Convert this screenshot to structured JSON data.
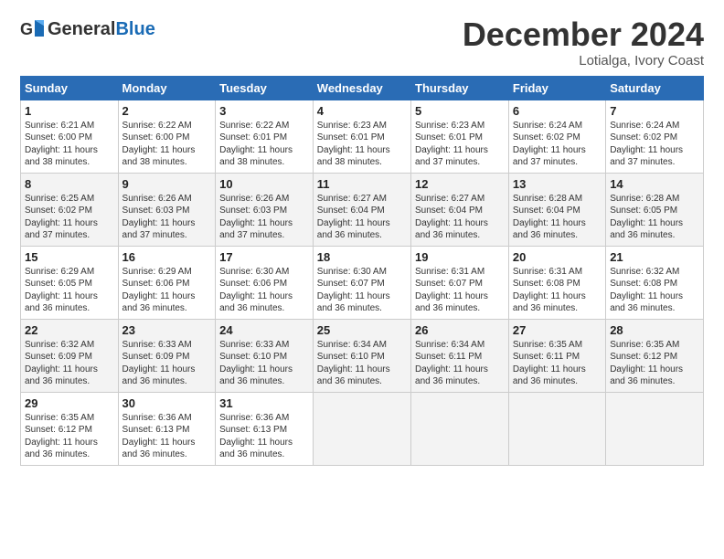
{
  "logo": {
    "general": "General",
    "blue": "Blue"
  },
  "title": "December 2024",
  "location": "Lotialga, Ivory Coast",
  "days_of_week": [
    "Sunday",
    "Monday",
    "Tuesday",
    "Wednesday",
    "Thursday",
    "Friday",
    "Saturday"
  ],
  "weeks": [
    [
      {
        "day": "1",
        "info": "Sunrise: 6:21 AM\nSunset: 6:00 PM\nDaylight: 11 hours\nand 38 minutes."
      },
      {
        "day": "2",
        "info": "Sunrise: 6:22 AM\nSunset: 6:00 PM\nDaylight: 11 hours\nand 38 minutes."
      },
      {
        "day": "3",
        "info": "Sunrise: 6:22 AM\nSunset: 6:01 PM\nDaylight: 11 hours\nand 38 minutes."
      },
      {
        "day": "4",
        "info": "Sunrise: 6:23 AM\nSunset: 6:01 PM\nDaylight: 11 hours\nand 38 minutes."
      },
      {
        "day": "5",
        "info": "Sunrise: 6:23 AM\nSunset: 6:01 PM\nDaylight: 11 hours\nand 37 minutes."
      },
      {
        "day": "6",
        "info": "Sunrise: 6:24 AM\nSunset: 6:02 PM\nDaylight: 11 hours\nand 37 minutes."
      },
      {
        "day": "7",
        "info": "Sunrise: 6:24 AM\nSunset: 6:02 PM\nDaylight: 11 hours\nand 37 minutes."
      }
    ],
    [
      {
        "day": "8",
        "info": "Sunrise: 6:25 AM\nSunset: 6:02 PM\nDaylight: 11 hours\nand 37 minutes."
      },
      {
        "day": "9",
        "info": "Sunrise: 6:26 AM\nSunset: 6:03 PM\nDaylight: 11 hours\nand 37 minutes."
      },
      {
        "day": "10",
        "info": "Sunrise: 6:26 AM\nSunset: 6:03 PM\nDaylight: 11 hours\nand 37 minutes."
      },
      {
        "day": "11",
        "info": "Sunrise: 6:27 AM\nSunset: 6:04 PM\nDaylight: 11 hours\nand 36 minutes."
      },
      {
        "day": "12",
        "info": "Sunrise: 6:27 AM\nSunset: 6:04 PM\nDaylight: 11 hours\nand 36 minutes."
      },
      {
        "day": "13",
        "info": "Sunrise: 6:28 AM\nSunset: 6:04 PM\nDaylight: 11 hours\nand 36 minutes."
      },
      {
        "day": "14",
        "info": "Sunrise: 6:28 AM\nSunset: 6:05 PM\nDaylight: 11 hours\nand 36 minutes."
      }
    ],
    [
      {
        "day": "15",
        "info": "Sunrise: 6:29 AM\nSunset: 6:05 PM\nDaylight: 11 hours\nand 36 minutes."
      },
      {
        "day": "16",
        "info": "Sunrise: 6:29 AM\nSunset: 6:06 PM\nDaylight: 11 hours\nand 36 minutes."
      },
      {
        "day": "17",
        "info": "Sunrise: 6:30 AM\nSunset: 6:06 PM\nDaylight: 11 hours\nand 36 minutes."
      },
      {
        "day": "18",
        "info": "Sunrise: 6:30 AM\nSunset: 6:07 PM\nDaylight: 11 hours\nand 36 minutes."
      },
      {
        "day": "19",
        "info": "Sunrise: 6:31 AM\nSunset: 6:07 PM\nDaylight: 11 hours\nand 36 minutes."
      },
      {
        "day": "20",
        "info": "Sunrise: 6:31 AM\nSunset: 6:08 PM\nDaylight: 11 hours\nand 36 minutes."
      },
      {
        "day": "21",
        "info": "Sunrise: 6:32 AM\nSunset: 6:08 PM\nDaylight: 11 hours\nand 36 minutes."
      }
    ],
    [
      {
        "day": "22",
        "info": "Sunrise: 6:32 AM\nSunset: 6:09 PM\nDaylight: 11 hours\nand 36 minutes."
      },
      {
        "day": "23",
        "info": "Sunrise: 6:33 AM\nSunset: 6:09 PM\nDaylight: 11 hours\nand 36 minutes."
      },
      {
        "day": "24",
        "info": "Sunrise: 6:33 AM\nSunset: 6:10 PM\nDaylight: 11 hours\nand 36 minutes."
      },
      {
        "day": "25",
        "info": "Sunrise: 6:34 AM\nSunset: 6:10 PM\nDaylight: 11 hours\nand 36 minutes."
      },
      {
        "day": "26",
        "info": "Sunrise: 6:34 AM\nSunset: 6:11 PM\nDaylight: 11 hours\nand 36 minutes."
      },
      {
        "day": "27",
        "info": "Sunrise: 6:35 AM\nSunset: 6:11 PM\nDaylight: 11 hours\nand 36 minutes."
      },
      {
        "day": "28",
        "info": "Sunrise: 6:35 AM\nSunset: 6:12 PM\nDaylight: 11 hours\nand 36 minutes."
      }
    ],
    [
      {
        "day": "29",
        "info": "Sunrise: 6:35 AM\nSunset: 6:12 PM\nDaylight: 11 hours\nand 36 minutes."
      },
      {
        "day": "30",
        "info": "Sunrise: 6:36 AM\nSunset: 6:13 PM\nDaylight: 11 hours\nand 36 minutes."
      },
      {
        "day": "31",
        "info": "Sunrise: 6:36 AM\nSunset: 6:13 PM\nDaylight: 11 hours\nand 36 minutes."
      },
      {
        "day": "",
        "info": ""
      },
      {
        "day": "",
        "info": ""
      },
      {
        "day": "",
        "info": ""
      },
      {
        "day": "",
        "info": ""
      }
    ]
  ]
}
